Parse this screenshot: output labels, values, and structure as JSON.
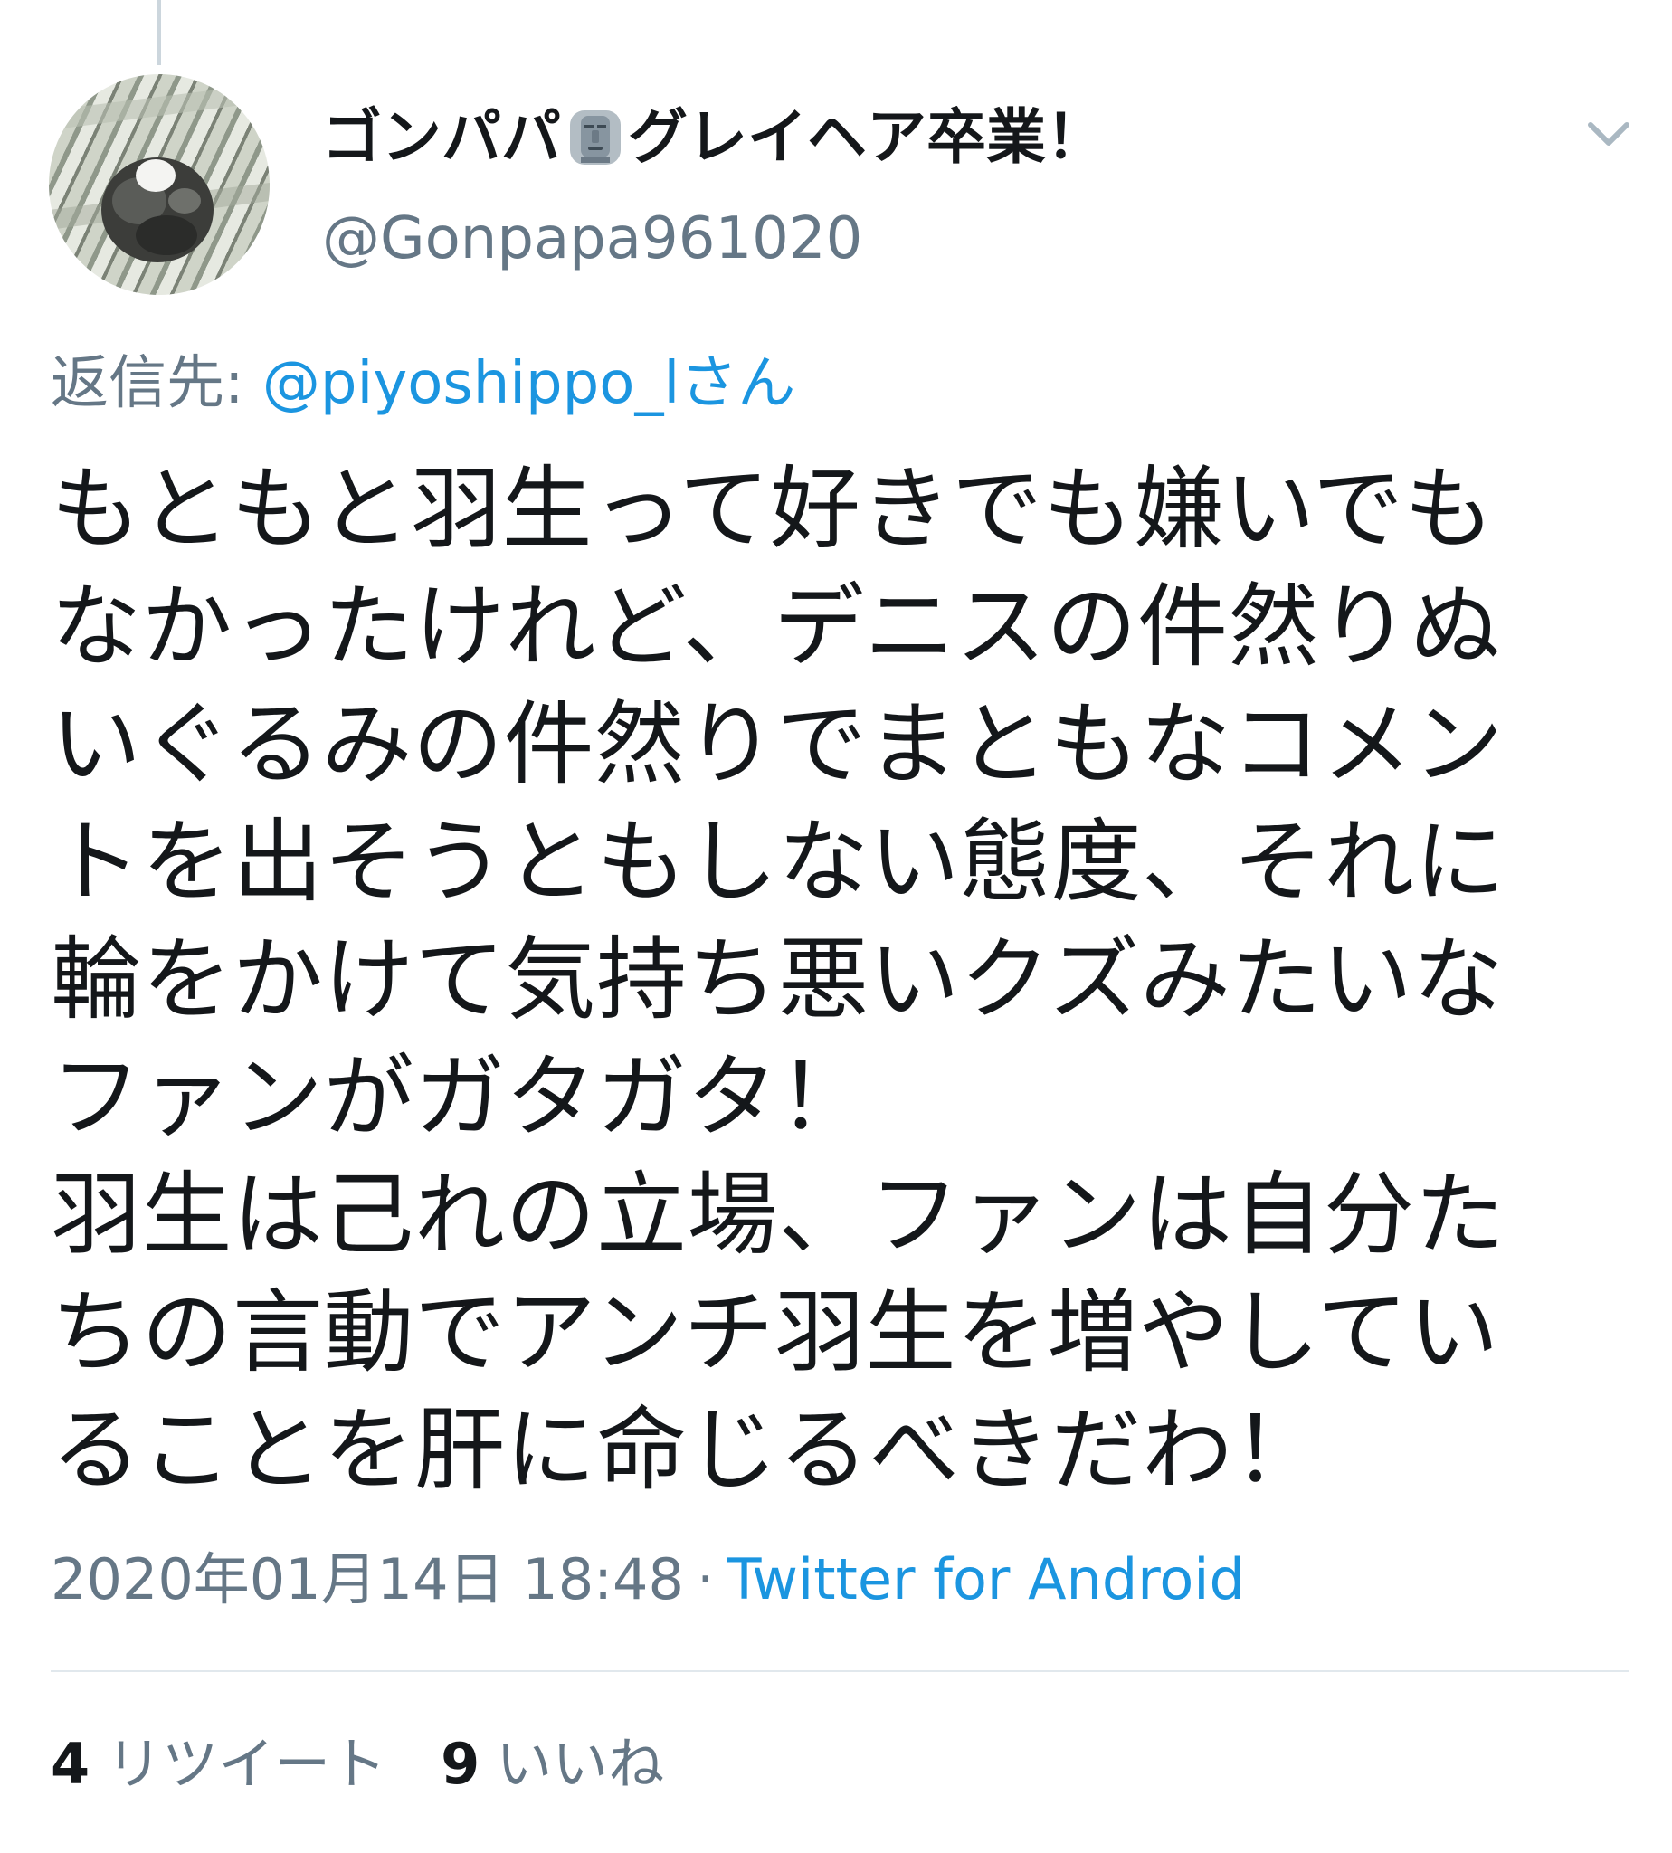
{
  "tweet": {
    "display_name_part1": "ゴンパパ",
    "display_name_part2": "グレイヘア卒業！",
    "name_emoji_icon": "moai-icon",
    "handle": "@Gonpapa961020",
    "menu_icon": "chevron-down-icon",
    "reply_label": "返信先: ",
    "reply_to": "@piyoshippo_lさん",
    "body_lines": [
      "もともと羽生って好きでも嫌いでも",
      "なかったけれど、デニスの件然りぬ",
      "いぐるみの件然りでまともなコメン",
      "トを出そうともしない態度、それに",
      "輪をかけて気持ち悪いクズみたいな",
      "ファンがガタガタ！",
      "羽生は己れの立場、ファンは自分た",
      "ちの言動でアンチ羽生を増やしてい",
      "ることを肝に命じるべきだわ！"
    ],
    "timestamp": "2020年01月14日 18:48",
    "separator": "·",
    "source": "Twitter for Android",
    "retweet_count": "4",
    "retweet_label": "リツイート",
    "like_count": "9",
    "like_label": "いいね"
  },
  "colors": {
    "text": "#14171a",
    "secondary": "#657786",
    "link": "#1b95e0",
    "divider": "#e1e8ed"
  }
}
